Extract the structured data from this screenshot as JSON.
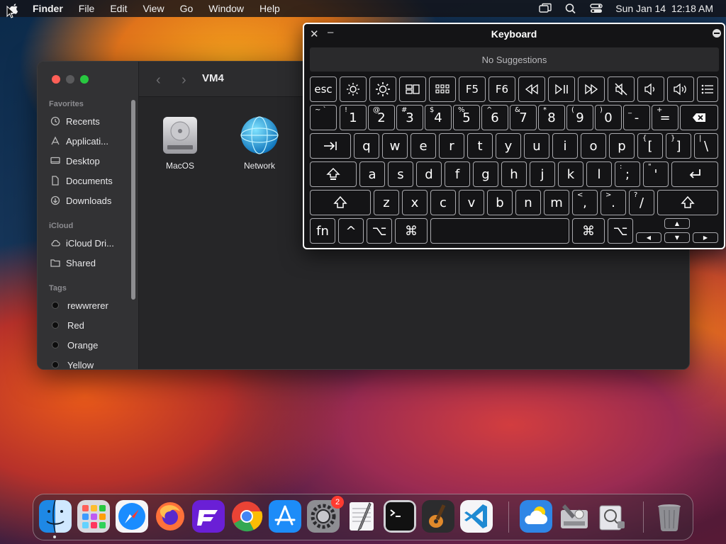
{
  "menubar": {
    "app": "Finder",
    "items": [
      "File",
      "Edit",
      "View",
      "Go",
      "Window",
      "Help"
    ],
    "datetime": "Sun Jan 14  12:18 AM"
  },
  "finder": {
    "title": "VM4",
    "sidebar": {
      "favorites_header": "Favorites",
      "favorites": [
        "Recents",
        "Applicati...",
        "Desktop",
        "Documents",
        "Downloads"
      ],
      "icloud_header": "iCloud",
      "icloud": [
        "iCloud Dri...",
        "Shared"
      ],
      "tags_header": "Tags",
      "tags": [
        "rewwrerer",
        "Red",
        "Orange",
        "Yellow"
      ]
    },
    "files": [
      "MacOS",
      "Network"
    ]
  },
  "keyboard": {
    "title": "Keyboard",
    "suggestions": "No Suggestions",
    "row_fn": [
      "esc",
      "F5",
      "F6"
    ],
    "row_num": [
      {
        "top": "~ `",
        "main": ""
      },
      {
        "top": "!",
        "main": "1"
      },
      {
        "top": "@",
        "main": "2"
      },
      {
        "top": "#",
        "main": "3"
      },
      {
        "top": "$",
        "main": "4"
      },
      {
        "top": "%",
        "main": "5"
      },
      {
        "top": "^",
        "main": "6"
      },
      {
        "top": "&",
        "main": "7"
      },
      {
        "top": "*",
        "main": "8"
      },
      {
        "top": "(",
        "main": "9"
      },
      {
        "top": ")",
        "main": "0"
      },
      {
        "top": "_",
        "main": "-"
      },
      {
        "top": "+",
        "main": "="
      }
    ],
    "row_q": [
      "q",
      "w",
      "e",
      "r",
      "t",
      "y",
      "u",
      "i",
      "o",
      "p"
    ],
    "row_q_extra": [
      {
        "top": "{",
        "main": "["
      },
      {
        "top": "}",
        "main": "]"
      },
      {
        "top": "|",
        "main": "\\"
      }
    ],
    "row_a": [
      "a",
      "s",
      "d",
      "f",
      "g",
      "h",
      "j",
      "k",
      "l"
    ],
    "row_a_extra": [
      {
        "top": ":",
        "main": ";"
      },
      {
        "top": "\"",
        "main": "'"
      }
    ],
    "row_z": [
      "z",
      "x",
      "c",
      "v",
      "b",
      "n",
      "m"
    ],
    "row_z_extra": [
      {
        "top": "<",
        "main": ","
      },
      {
        "top": ">",
        "main": "."
      },
      {
        "top": "?",
        "main": "/"
      }
    ],
    "bottom": {
      "fn": "fn",
      "ctrl": "^",
      "opt": "⌥",
      "cmd": "⌘",
      "cmd_r": "⌘",
      "opt_r": "⌥"
    },
    "arrows": {
      "up": "▲",
      "left": "◀",
      "down": "▼",
      "right": "▶"
    }
  },
  "dock": {
    "apps": [
      "finder",
      "launchpad",
      "safari",
      "firefox",
      "fenix",
      "chrome",
      "app-store",
      "system-settings",
      "textedit",
      "terminal",
      "garageband",
      "vscode",
      "weather",
      "disk-utility",
      "system-information",
      "trash"
    ],
    "settings_badge": "2"
  }
}
